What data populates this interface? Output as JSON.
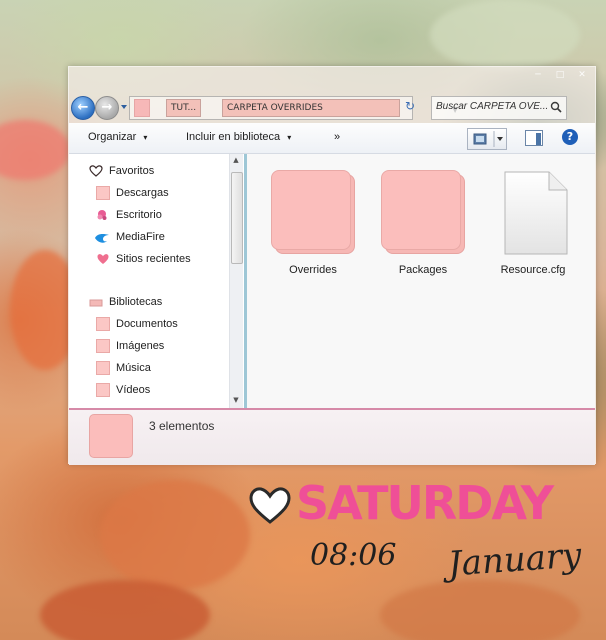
{
  "window": {
    "address": {
      "crumbs": [
        "TUT...",
        "CARPETA OVERRIDES"
      ]
    },
    "search": {
      "placeholder": "Buscar CARPETA OVE..."
    },
    "toolbar": {
      "organize": "Organizar",
      "organize_arrow": "▾",
      "include_library": "Incluir en biblioteca",
      "include_arrow": "▾",
      "more": "»"
    },
    "nav_pane": {
      "favorites_header": "Favoritos",
      "favorites": [
        {
          "label": "Descargas",
          "icon": "pink-folder-icon"
        },
        {
          "label": "Escritorio",
          "icon": "pink-creature-icon"
        },
        {
          "label": "MediaFire",
          "icon": "mediafire-icon"
        },
        {
          "label": "Sitios recientes",
          "icon": "heart-icon"
        }
      ],
      "libraries_header": "Bibliotecas",
      "libraries": [
        {
          "label": "Documentos",
          "icon": "pink-folder-icon"
        },
        {
          "label": "Imágenes",
          "icon": "pink-folder-icon"
        },
        {
          "label": "Música",
          "icon": "pink-folder-icon"
        },
        {
          "label": "Vídeos",
          "icon": "pink-folder-icon"
        }
      ]
    },
    "content": {
      "items": [
        {
          "name": "Overrides",
          "type": "folder"
        },
        {
          "name": "Packages",
          "type": "folder"
        },
        {
          "name": "Resource.cfg",
          "type": "file"
        }
      ]
    },
    "details": {
      "count_text": "3 elementos"
    }
  },
  "desktop": {
    "day": "SATURDAY",
    "time": "08:06",
    "month": "January"
  },
  "colors": {
    "folder_pink": "#fbbebc",
    "accent_pink": "#ef4f97",
    "nav_blue": "#2d6fc1"
  }
}
